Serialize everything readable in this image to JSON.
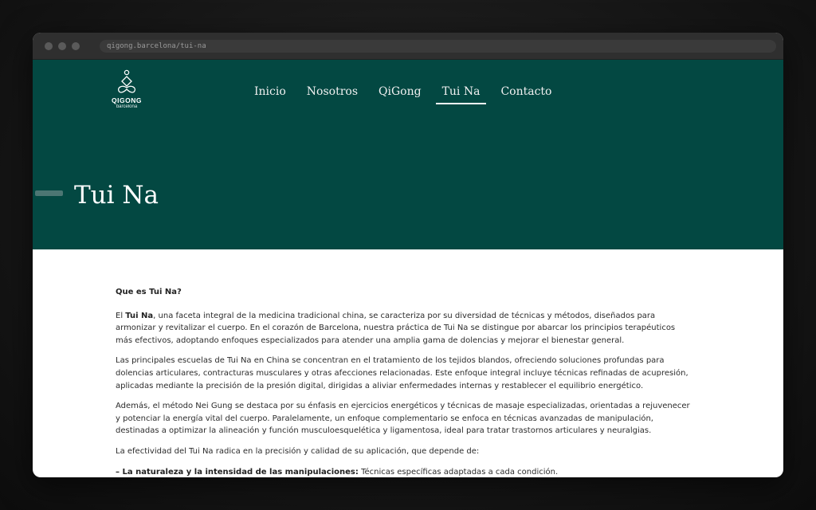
{
  "browser": {
    "url": "qigong.barcelona/tui-na"
  },
  "logo": {
    "name": "QIGONG",
    "sub": "barcelona",
    "icon": "meditation-figure-icon"
  },
  "nav": [
    {
      "label": "Inicio"
    },
    {
      "label": "Nosotros"
    },
    {
      "label": "QiGong"
    },
    {
      "label": "Tui Na",
      "active": true
    },
    {
      "label": "Contacto"
    }
  ],
  "hero": {
    "title": "Tui Na"
  },
  "content": {
    "heading": "Que es Tui Na?",
    "p1_before": "El ",
    "p1_strong": "Tui Na",
    "p1_after": ", una faceta integral de la medicina tradicional china, se caracteriza por su diversidad de técnicas y métodos, diseñados para armonizar y revitalizar el cuerpo. En el corazón de Barcelona, nuestra práctica de Tui Na se distingue por abarcar los principios terapéuticos más efectivos, adoptando enfoques especializados para atender una amplia gama de dolencias y mejorar el bienestar general.",
    "p2": "Las principales escuelas de Tui Na en China se concentran en el tratamiento de los tejidos blandos, ofreciendo soluciones profundas para dolencias articulares, contracturas musculares y otras afecciones relacionadas. Este enfoque integral incluye técnicas refinadas de acupresión, aplicadas mediante la precisión de la presión digital, dirigidas a aliviar enfermedades internas y restablecer el equilibrio energético.",
    "p3": "Además, el método Nei Gung se destaca por su énfasis en ejercicios energéticos y técnicas de masaje especializadas, orientadas a rejuvenecer y potenciar la energía vital del cuerpo. Paralelamente, un enfoque complementario se enfoca en técnicas avanzadas de manipulación, destinadas a optimizar la alineación y función musculoesquelética y ligamentosa, ideal para tratar trastornos articulares y neuralgias.",
    "p4": "La efectividad del Tui Na radica en la precisión y calidad de su aplicación, que depende de:",
    "p5_strong": "– La naturaleza y la intensidad de las manipulaciones:",
    "p5_after": " Técnicas específicas adaptadas a cada condición."
  }
}
